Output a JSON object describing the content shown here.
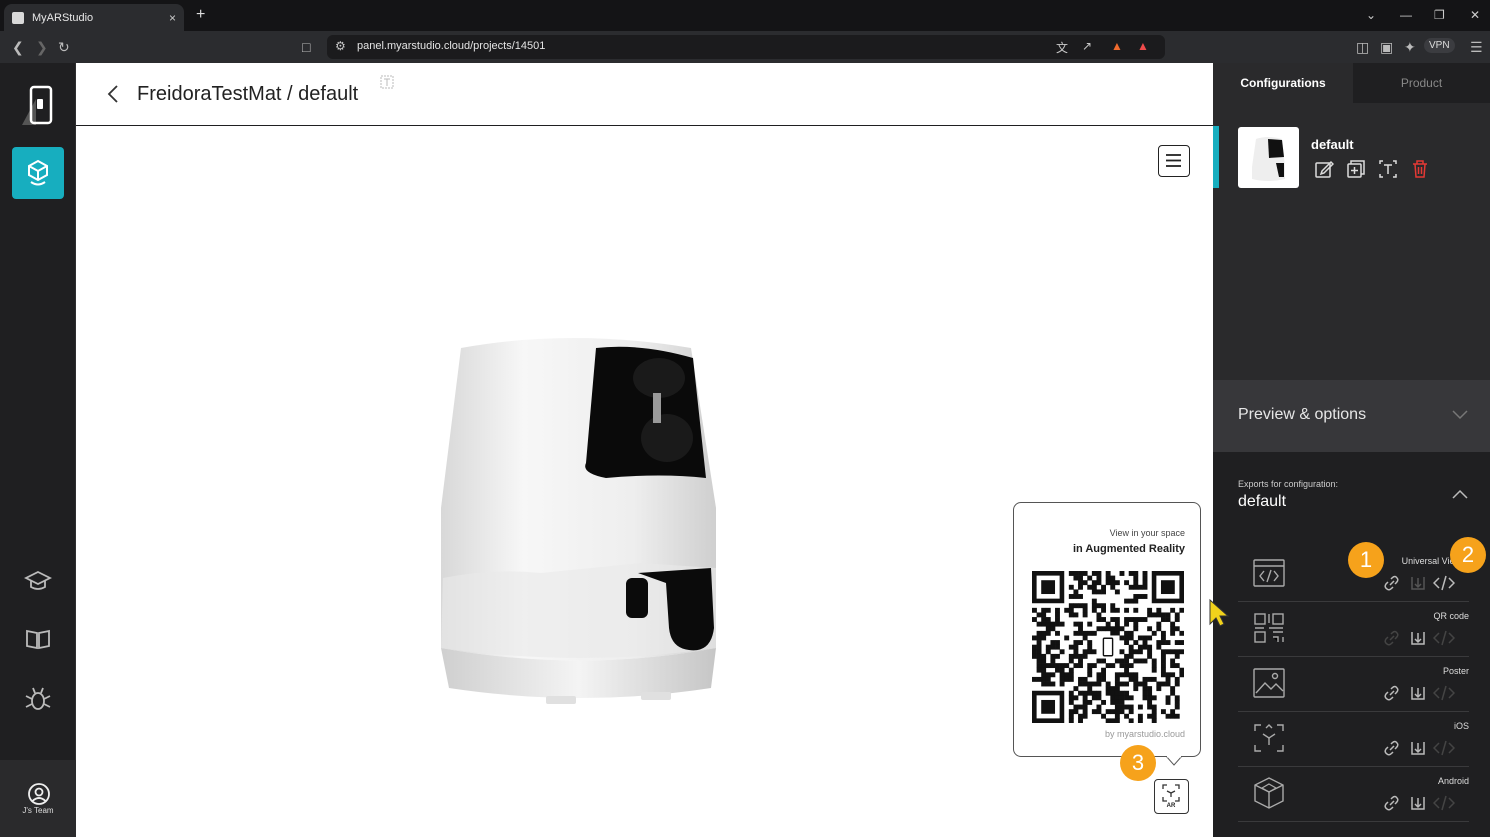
{
  "browser": {
    "tab_title": "MyARStudio",
    "tab_close": "×",
    "new_tab": "+",
    "url": "panel.myarstudio.cloud/projects/14501",
    "vpn_label": "VPN"
  },
  "sidebar": {
    "user_label": "J's Team"
  },
  "header": {
    "title": "FreidoraTestMat / default"
  },
  "right_panel": {
    "tabs": [
      {
        "label": "Configurations"
      },
      {
        "label": "Product"
      }
    ],
    "config": {
      "name": "default"
    },
    "preview_title": "Preview & options",
    "exports_label": "Exports for configuration:",
    "exports_config": "default",
    "exports": [
      {
        "label": "Universal Viewer"
      },
      {
        "label": "QR code"
      },
      {
        "label": "Poster"
      },
      {
        "label": "iOS"
      },
      {
        "label": "Android"
      }
    ]
  },
  "qr_popup": {
    "line1": "View in your space",
    "line2": "in Augmented Reality",
    "credit": "by myarstudio.cloud"
  },
  "ar_button_label": "AR",
  "badges": [
    "1",
    "2",
    "3"
  ],
  "colors": {
    "accent": "#17aebf",
    "badge": "#f6a21b",
    "delete": "#e53935"
  }
}
